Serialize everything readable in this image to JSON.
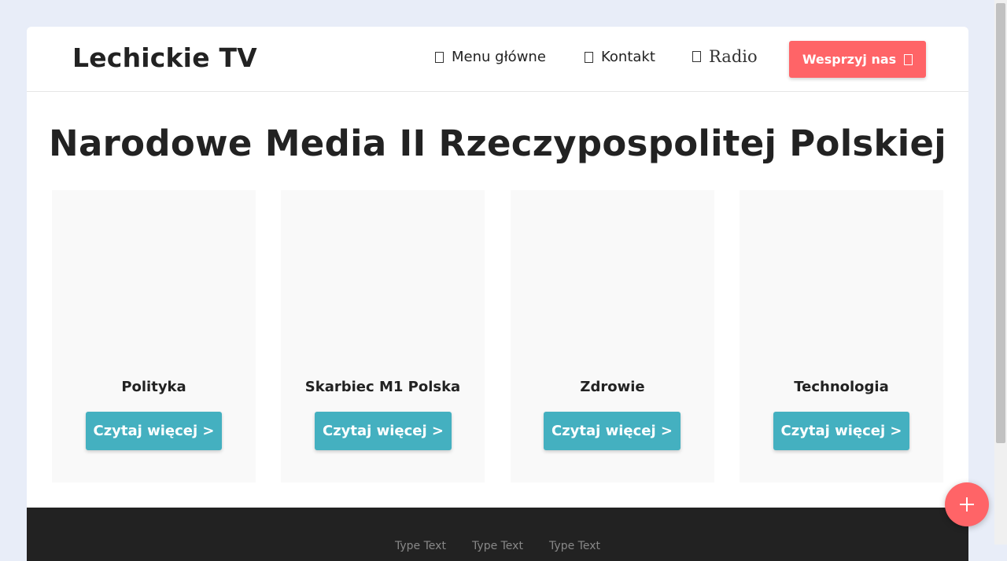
{
  "header": {
    "brand": "Lechickie TV",
    "nav": [
      {
        "label": "Menu główne",
        "icon": "box-icon"
      },
      {
        "label": "Kontakt",
        "icon": "box-icon"
      },
      {
        "label": "Radio",
        "icon": "box-icon"
      }
    ],
    "support_button": {
      "label": "Wesprzyj nas",
      "icon": "box-icon"
    }
  },
  "hero": {
    "title": "Narodowe Media II Rzeczypospolitej Polskiej"
  },
  "cards": [
    {
      "title": "Polityka",
      "button": "Czytaj więcej >"
    },
    {
      "title": "Skarbiec M1 Polska",
      "button": "Czytaj więcej >"
    },
    {
      "title": "Zdrowie",
      "button": "Czytaj więcej >"
    },
    {
      "title": "Technologia",
      "button": "Czytaj więcej >"
    }
  ],
  "footer": {
    "links": [
      "Type Text",
      "Type Text",
      "Type Text"
    ]
  },
  "fab": {
    "icon": "plus-icon"
  },
  "colors": {
    "accent": "#ff6467",
    "button_teal": "#44b0c0",
    "footer_bg": "#222222",
    "page_bg": "#e8edf8"
  }
}
